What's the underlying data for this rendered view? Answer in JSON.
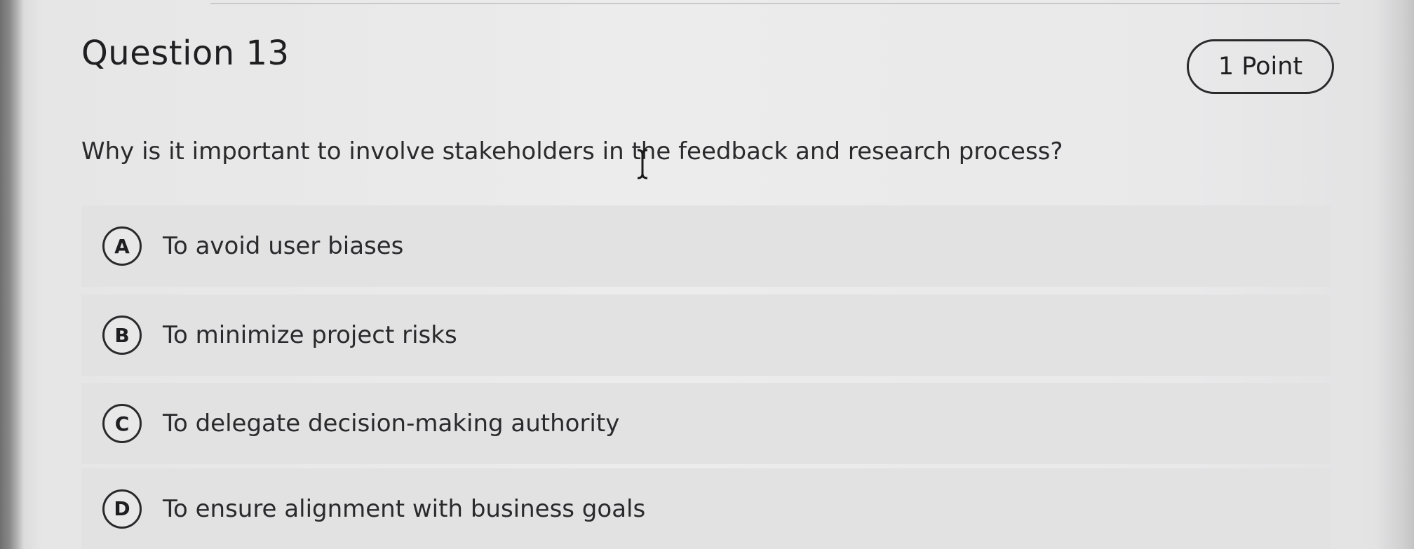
{
  "question": {
    "title": "Question 13",
    "points": "1 Point",
    "prompt": "Why is it important to involve stakeholders in the feedback and research process?"
  },
  "options": [
    {
      "letter": "A",
      "text": "To avoid user biases"
    },
    {
      "letter": "B",
      "text": "To minimize project risks"
    },
    {
      "letter": "C",
      "text": "To delegate decision-making authority"
    },
    {
      "letter": "D",
      "text": "To ensure alignment with business goals"
    }
  ],
  "icons": {
    "cursor": "text-cursor-icon"
  }
}
